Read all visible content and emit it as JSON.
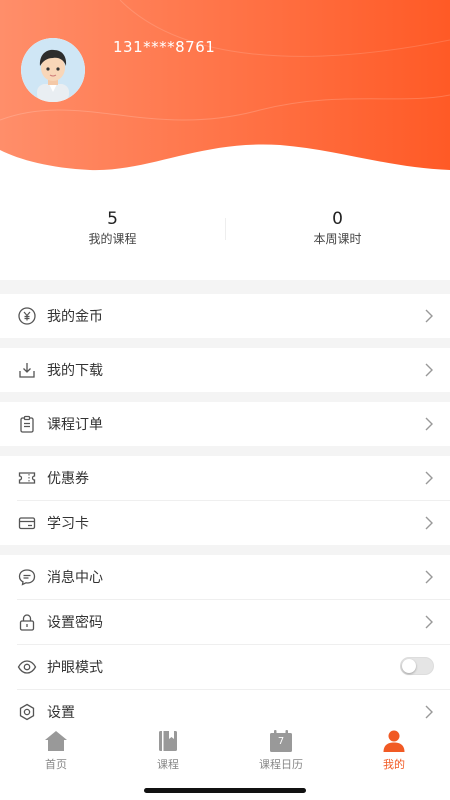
{
  "profile": {
    "phone": "131****8761",
    "header_color": "#ff5d2e",
    "header_color_light": "#ff8e6a"
  },
  "stats": [
    {
      "value": "5",
      "label": "我的课程"
    },
    {
      "value": "0",
      "label": "本周课时"
    }
  ],
  "menu": [
    {
      "label": "我的金币",
      "icon": "coin-icon"
    },
    {
      "label": "我的下载",
      "icon": "download-icon"
    },
    {
      "label": "课程订单",
      "icon": "clipboard-icon"
    },
    {
      "label": "优惠券",
      "icon": "coupon-icon"
    },
    {
      "label": "学习卡",
      "icon": "card-icon"
    },
    {
      "label": "消息中心",
      "icon": "message-icon"
    },
    {
      "label": "设置密码",
      "icon": "lock-icon"
    },
    {
      "label": "护眼模式",
      "icon": "eye-icon"
    },
    {
      "label": "设置",
      "icon": "gear-icon"
    }
  ],
  "tabs": [
    {
      "label": "首页",
      "icon": "home-icon"
    },
    {
      "label": "课程",
      "icon": "book-icon"
    },
    {
      "label": "课程日历",
      "icon": "calendar-icon",
      "calendar_day": "7"
    },
    {
      "label": "我的",
      "icon": "person-icon",
      "active": true
    }
  ],
  "eye_mode_enabled": false
}
